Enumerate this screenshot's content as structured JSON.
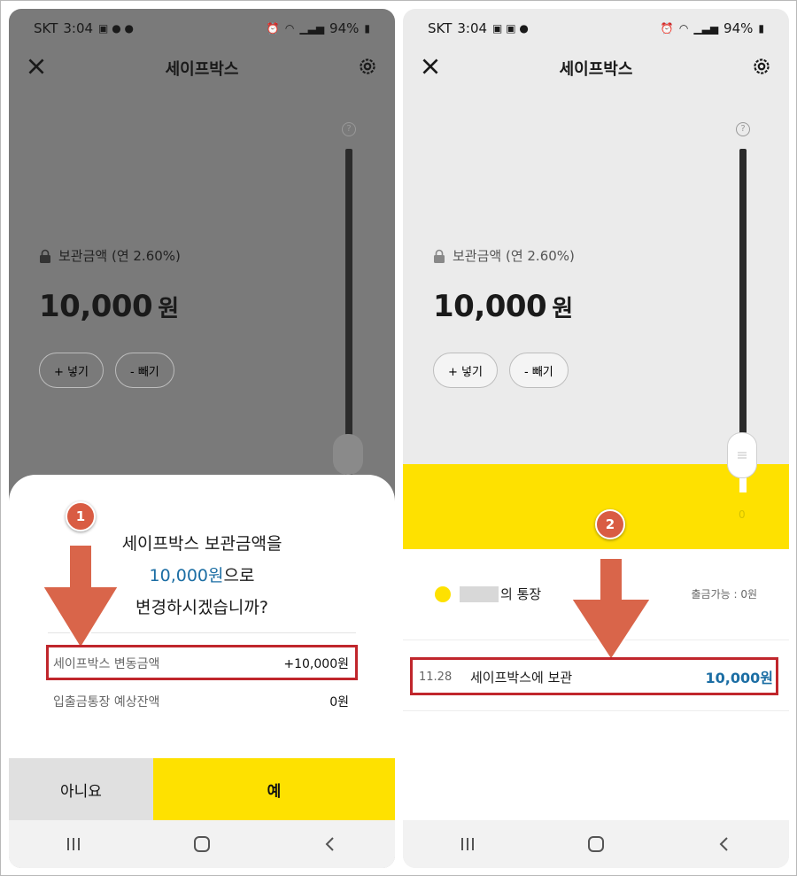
{
  "status": {
    "carrier": "SKT",
    "time": "3:04",
    "battery": "94%"
  },
  "app": {
    "title": "세이프박스"
  },
  "balance": {
    "label": "보관금액 (연 2.60%)",
    "amount": "10,000",
    "unit": "원"
  },
  "actions": {
    "deposit": "+ 넣기",
    "withdraw": "- 빼기"
  },
  "slider": {
    "help": "?",
    "min_label": "0"
  },
  "dialog": {
    "line1": "세이프박스 보관금액을",
    "amount_highlight": "10,000원",
    "line2_suffix": "으로",
    "line3": "변경하시겠습니까?",
    "rows": [
      {
        "label": "세이프박스 변동금액",
        "value": "+10,000원"
      },
      {
        "label": "입출금통장 예상잔액",
        "value": "0원"
      }
    ],
    "no_label": "아니요",
    "yes_label": "예"
  },
  "account": {
    "name_suffix": "의 통장",
    "available": "출금가능 : 0원"
  },
  "transaction": {
    "date": "11.28",
    "desc": "세이프박스에 보관",
    "amount": "10,000원"
  },
  "annotations": {
    "step1": "1",
    "step2": "2"
  },
  "colors": {
    "yellow": "#fee100",
    "blue": "#1c6ea4",
    "red_box": "#c0262c",
    "badge": "#d95c43",
    "arrow": "#d9654a"
  }
}
